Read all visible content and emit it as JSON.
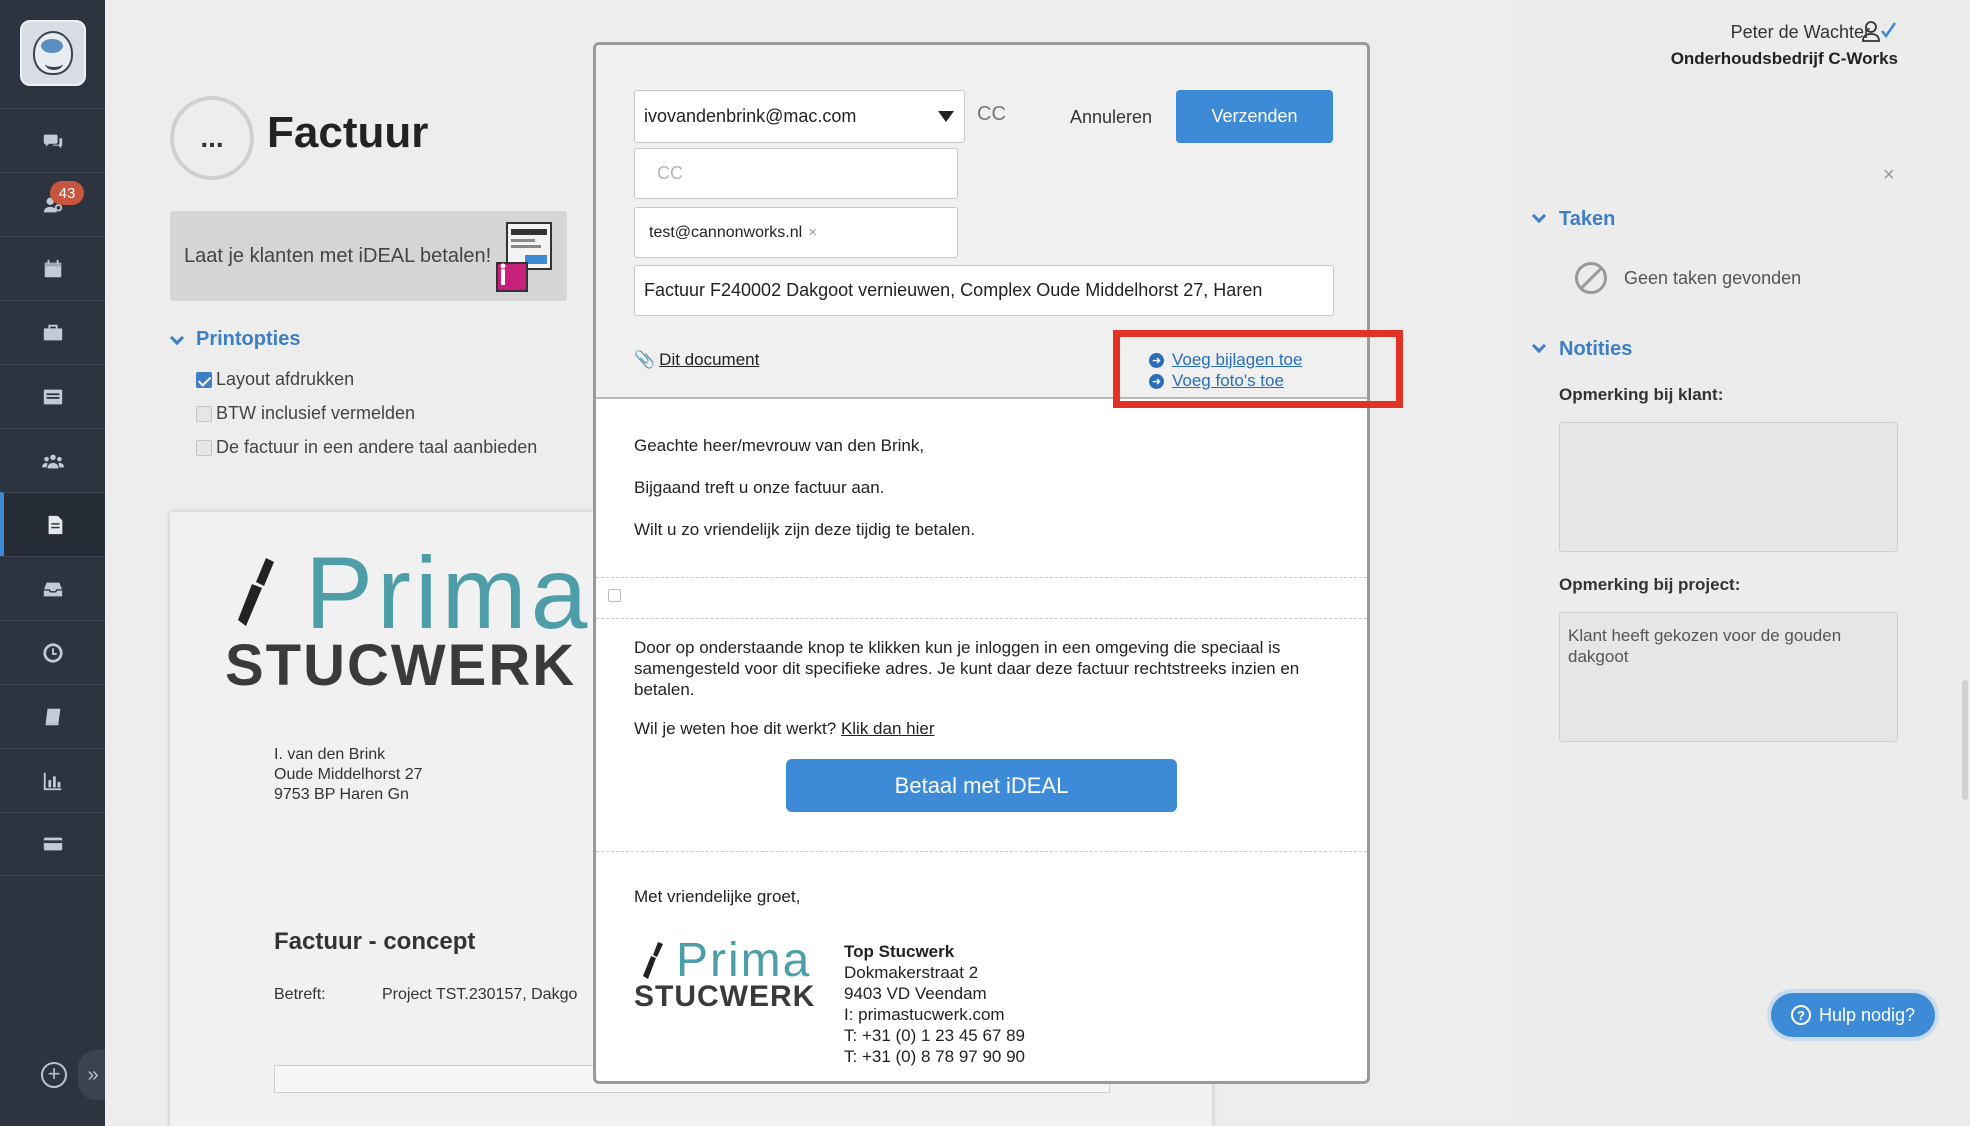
{
  "sidebar": {
    "badge": "43",
    "items": [
      {
        "icon": "chat-icon"
      },
      {
        "icon": "users-cog-icon"
      },
      {
        "icon": "calendar-icon"
      },
      {
        "icon": "briefcase-icon"
      },
      {
        "icon": "list-icon"
      },
      {
        "icon": "team-icon"
      },
      {
        "icon": "document-icon",
        "active": true
      },
      {
        "icon": "inbox-icon"
      },
      {
        "icon": "clock-icon"
      },
      {
        "icon": "book-icon"
      },
      {
        "icon": "chart-icon"
      },
      {
        "icon": "credit-card-icon"
      }
    ]
  },
  "main": {
    "back_label": "...",
    "title": "Factuur",
    "ideal_banner": "Laat je klanten met iDEAL betalen!",
    "print_title": "Printopties",
    "print_options": [
      {
        "label": "Layout afdrukken",
        "checked": true
      },
      {
        "label": "BTW inclusief vermelden",
        "checked": false
      },
      {
        "label": "De factuur in een andere taal aanbieden",
        "checked": false
      }
    ],
    "document": {
      "logo_top": "Prima",
      "logo_bottom": "STUCWERK",
      "address": [
        "I. van den Brink",
        "Oude Middelhorst 27",
        "9753 BP Haren Gn"
      ],
      "heading": "Factuur - concept",
      "betreft_label": "Betreft:",
      "betreft_value": "Project TST.230157, Dakgo"
    }
  },
  "right_panel": {
    "user": "Peter de Wachter",
    "company": "Onderhoudsbedrijf C-Works",
    "close": "×",
    "tasks_title": "Taken",
    "no_tasks": "Geen taken gevonden",
    "notes_title": "Notities",
    "note_client_label": "Opmerking bij klant:",
    "note_client_value": "",
    "note_project_label": "Opmerking bij project:",
    "note_project_value": "Klant heeft gekozen voor de gouden dakgoot",
    "help": "Hulp nodig?",
    "help_icon": "?"
  },
  "modal": {
    "to": "ivovandenbrink@mac.com",
    "cc_link": "CC",
    "cancel": "Annuleren",
    "send": "Verzenden",
    "cc_placeholder": "CC",
    "bcc_tag": "test@cannonworks.nl",
    "bcc_tag_remove": "×",
    "subject": "Factuur F240002 Dakgoot vernieuwen, Complex Oude Middelhorst 27, Haren",
    "attachment": "Dit document",
    "add_attachments": "Voeg bijlagen toe",
    "add_photos": "Voeg foto's toe",
    "body": {
      "greeting": "Geachte heer/mevrouw van den Brink,",
      "line1": "Bijgaand treft u onze factuur aan.",
      "line2": "Wilt u zo vriendelijk zijn deze tijdig te betalen.",
      "portal_text": "Door op onderstaande knop te klikken kun je inloggen in een omgeving die speciaal is samengesteld voor dit specifieke adres. Je kunt daar deze factuur rechtstreeks inzien en betalen.",
      "how_text": "Wil je weten hoe dit werkt?",
      "how_link": "Klik dan hier",
      "pay_button": "Betaal met iDEAL",
      "closing": "Met vriendelijke groet,",
      "sig_logo_top": "Prima",
      "sig_logo_bottom": "STUCWERK",
      "company": "Top Stucwerk",
      "street": "Dokmakerstraat 2",
      "city": "9403 VD Veendam",
      "web": "I: primastucwerk.com",
      "phone1": "T: +31 (0) 1 23 45 67 89",
      "phone2": "T: +31 (0) 8 78 97 90 90"
    }
  },
  "colors": {
    "accent": "#3d8ad6",
    "sidebar": "#2c3440",
    "highlight": "#e03325",
    "brand_teal": "#4e9ea8"
  }
}
